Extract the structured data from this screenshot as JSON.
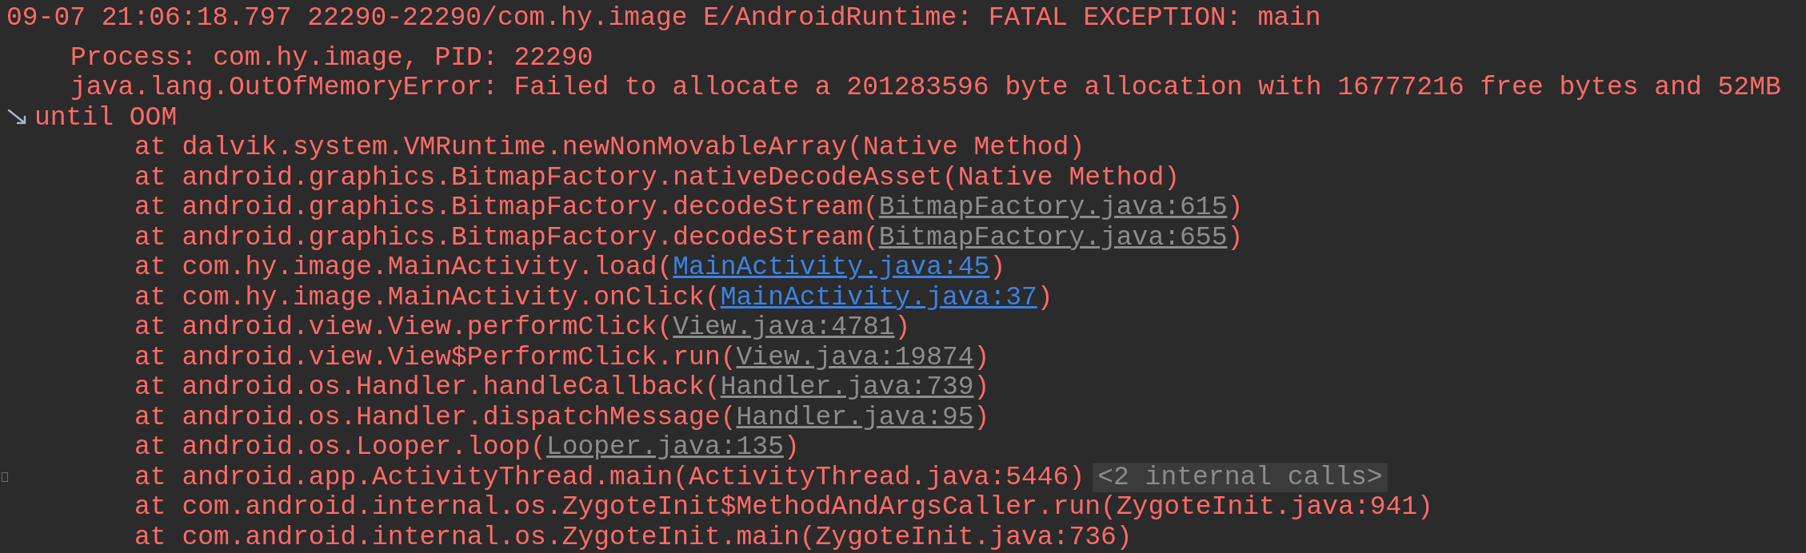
{
  "log_lines": [
    {
      "kind": "header",
      "segments": [
        {
          "kind": "plain",
          "text": "09-07 21:06:18.797 22290-22290/com.hy.image E/AndroidRuntime: FATAL EXCEPTION: main"
        }
      ]
    },
    {
      "kind": "detail",
      "segments": [
        {
          "kind": "plain",
          "text": "Process: com.hy.image, PID: 22290"
        }
      ]
    },
    {
      "kind": "detail",
      "segments": [
        {
          "kind": "plain",
          "text": "java.lang.OutOfMemoryError: Failed to allocate a 201283596 byte allocation with 16777216 free bytes and 52MB"
        }
      ]
    },
    {
      "kind": "wrapped",
      "segments": [
        {
          "kind": "plain",
          "text": "until OOM"
        }
      ]
    },
    {
      "kind": "frame",
      "segments": [
        {
          "kind": "plain",
          "text": "at dalvik.system.VMRuntime.newNonMovableArray(Native Method)"
        }
      ]
    },
    {
      "kind": "frame",
      "segments": [
        {
          "kind": "plain",
          "text": "at android.graphics.BitmapFactory.nativeDecodeAsset(Native Method)"
        }
      ]
    },
    {
      "kind": "frame",
      "segments": [
        {
          "kind": "plain",
          "text": "at android.graphics.BitmapFactory.decodeStream("
        },
        {
          "kind": "library-link",
          "text": "BitmapFactory.java:615"
        },
        {
          "kind": "plain",
          "text": ")"
        }
      ]
    },
    {
      "kind": "frame",
      "segments": [
        {
          "kind": "plain",
          "text": "at android.graphics.BitmapFactory.decodeStream("
        },
        {
          "kind": "library-link",
          "text": "BitmapFactory.java:655"
        },
        {
          "kind": "plain",
          "text": ")"
        }
      ]
    },
    {
      "kind": "frame",
      "segments": [
        {
          "kind": "plain",
          "text": "at com.hy.image.MainActivity.load("
        },
        {
          "kind": "project-link",
          "text": "MainActivity.java:45"
        },
        {
          "kind": "plain",
          "text": ")"
        }
      ]
    },
    {
      "kind": "frame",
      "segments": [
        {
          "kind": "plain",
          "text": "at com.hy.image.MainActivity.onClick("
        },
        {
          "kind": "project-link",
          "text": "MainActivity.java:37"
        },
        {
          "kind": "plain",
          "text": ")"
        }
      ]
    },
    {
      "kind": "frame",
      "segments": [
        {
          "kind": "plain",
          "text": "at android.view.View.performClick("
        },
        {
          "kind": "library-link",
          "text": "View.java:4781"
        },
        {
          "kind": "plain",
          "text": ")"
        }
      ]
    },
    {
      "kind": "frame",
      "segments": [
        {
          "kind": "plain",
          "text": "at android.view.View$PerformClick.run("
        },
        {
          "kind": "library-link",
          "text": "View.java:19874"
        },
        {
          "kind": "plain",
          "text": ")"
        }
      ]
    },
    {
      "kind": "frame",
      "segments": [
        {
          "kind": "plain",
          "text": "at android.os.Handler.handleCallback("
        },
        {
          "kind": "library-link",
          "text": "Handler.java:739"
        },
        {
          "kind": "plain",
          "text": ")"
        }
      ]
    },
    {
      "kind": "frame",
      "segments": [
        {
          "kind": "plain",
          "text": "at android.os.Handler.dispatchMessage("
        },
        {
          "kind": "library-link",
          "text": "Handler.java:95"
        },
        {
          "kind": "plain",
          "text": ")"
        }
      ]
    },
    {
      "kind": "frame",
      "segments": [
        {
          "kind": "plain",
          "text": "at android.os.Looper.loop("
        },
        {
          "kind": "library-link",
          "text": "Looper.java:135"
        },
        {
          "kind": "plain",
          "text": ")"
        }
      ]
    },
    {
      "kind": "frame",
      "folded": "<2 internal calls>",
      "segments": [
        {
          "kind": "plain",
          "text": "at android.app.ActivityThread.main(ActivityThread.java:5446)"
        }
      ]
    },
    {
      "kind": "frame",
      "segments": [
        {
          "kind": "plain",
          "text": "at com.android.internal.os.ZygoteInit$MethodAndArgsCaller.run(ZygoteInit.java:941)"
        }
      ]
    },
    {
      "kind": "frame",
      "segments": [
        {
          "kind": "plain",
          "text": "at com.android.internal.os.ZygoteInit.main(ZygoteInit.java:736)"
        }
      ]
    }
  ]
}
